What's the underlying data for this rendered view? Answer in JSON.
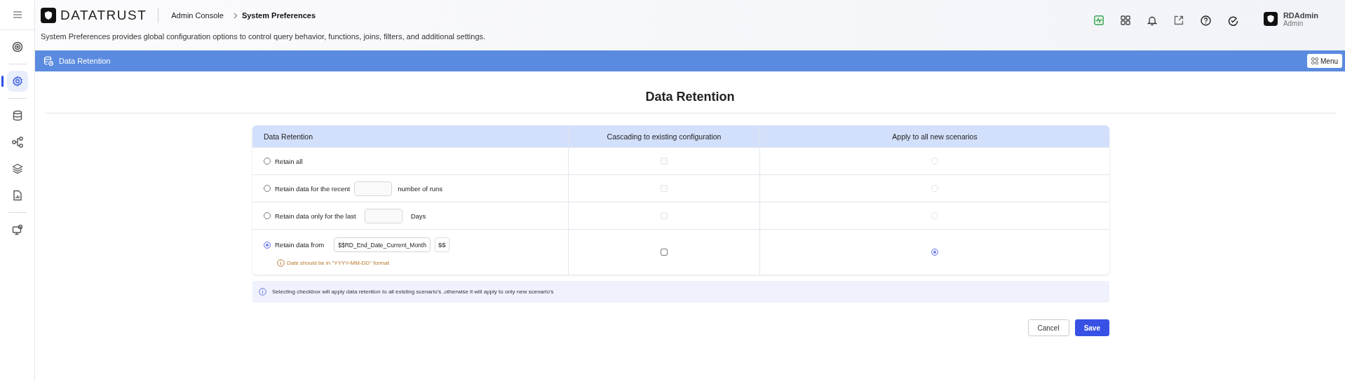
{
  "sidebar": {
    "groups": [
      [
        {
          "selected": false
        }
      ],
      [
        {
          "selected": true
        }
      ],
      [
        {
          "selected": false
        },
        {
          "selected": false
        },
        {
          "selected": false
        },
        {
          "selected": false
        }
      ],
      [
        {
          "selected": false
        }
      ]
    ]
  },
  "header": {
    "logo": "DATATRUST",
    "breadcrumb": [
      "Admin Console",
      "System Preferences"
    ],
    "description": "System Preferences provides global configuration options to control query behavior, functions, joins, filters, and additional settings.",
    "user": {
      "name": "RDAdmin",
      "role": "Admin"
    }
  },
  "section_bar": {
    "title": "Data Retention",
    "menu_button": "Menu"
  },
  "page_title": "Data Retention",
  "table": {
    "columns": [
      "Data Retention",
      "Cascading to existing configuration",
      "Apply to all new scenarios"
    ],
    "rows": [
      {
        "kind": "plain",
        "label": "Retain all",
        "selected": false,
        "cascade": {
          "checked": false,
          "disabled": true
        },
        "apply": {
          "selected": false,
          "disabled": true
        }
      },
      {
        "kind": "number",
        "label": "Retain data for the recent",
        "suffix": "number of runs",
        "selected": false,
        "cascade": {
          "checked": false,
          "disabled": true
        },
        "apply": {
          "selected": false,
          "disabled": true
        }
      },
      {
        "kind": "number",
        "label": "Retain data only for the last",
        "suffix": "Days",
        "selected": false,
        "cascade": {
          "checked": false,
          "disabled": true
        },
        "apply": {
          "selected": false,
          "disabled": true
        }
      },
      {
        "kind": "date",
        "label": "Retain data from",
        "value": "$$RD_End_Date_Current_Month",
        "variable_button": "$$",
        "hint": "Date should be in \"YYYY-MM-DD\" format",
        "selected": true,
        "cascade": {
          "checked": false,
          "disabled": false
        },
        "apply": {
          "selected": true,
          "disabled": false
        }
      }
    ]
  },
  "note": "Selecting checkbox will apply data retention to all existing scenario's ,otherwise it will apply to only new scenario's",
  "buttons": [
    "Cancel",
    "Save"
  ]
}
